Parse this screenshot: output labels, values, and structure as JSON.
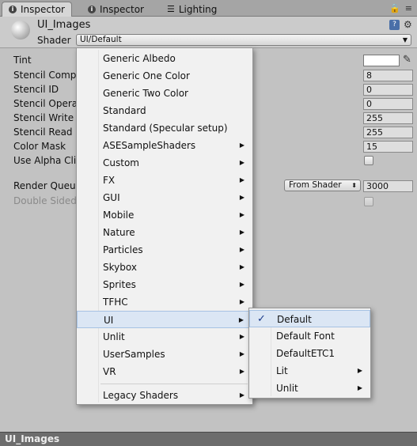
{
  "tabs": [
    {
      "label": "Inspector",
      "icon": "info-icon",
      "active": true
    },
    {
      "label": "Inspector",
      "icon": "info-icon",
      "active": false
    },
    {
      "label": "Lighting",
      "icon": "lighting-icon",
      "active": false
    }
  ],
  "header": {
    "object_name": "UI_Images",
    "shader_label": "Shader",
    "shader_value": "UI/Default"
  },
  "properties": {
    "tint": "Tint",
    "stencil_comparison": "Stencil Compa",
    "stencil_id": "Stencil ID",
    "stencil_operation": "Stencil Operat",
    "stencil_write_mask": "Stencil Write M",
    "stencil_read_mask": "Stencil Read M",
    "color_mask": "Color Mask",
    "use_alpha_clip": "Use Alpha Clip",
    "render_queue": "Render Queue",
    "double_sided": "Double Sided"
  },
  "values": {
    "stencil_comparison": "8",
    "stencil_id": "0",
    "stencil_operation": "0",
    "stencil_write_mask": "255",
    "stencil_read_mask": "255",
    "color_mask": "15",
    "render_queue_mode": "From Shader",
    "render_queue_value": "3000"
  },
  "menu": {
    "items": [
      "Generic Albedo",
      "Generic One Color",
      "Generic Two Color",
      "Standard",
      "Standard (Specular setup)",
      "ASESampleShaders",
      "Custom",
      "FX",
      "GUI",
      "Mobile",
      "Nature",
      "Particles",
      "Skybox",
      "Sprites",
      "TFHC",
      "UI",
      "Unlit",
      "UserSamples",
      "VR",
      "Legacy Shaders"
    ],
    "submenu_items": [
      "Default",
      "Default Font",
      "DefaultETC1",
      "Lit",
      "Unlit"
    ],
    "selected_submenu_item": "Default",
    "highlighted_item": "UI"
  },
  "footer": {
    "label": "UI_Images"
  }
}
